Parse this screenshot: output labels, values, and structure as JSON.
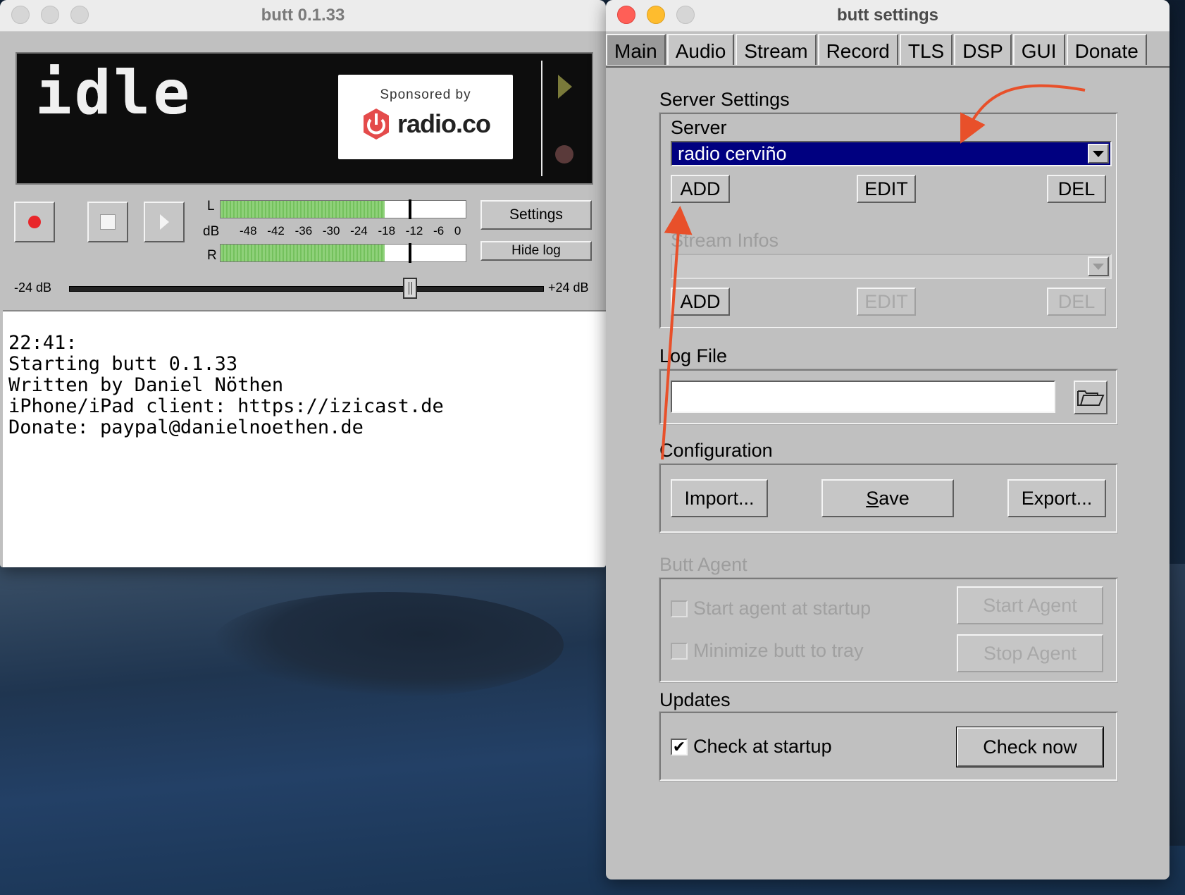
{
  "main_window": {
    "title": "butt 0.1.33",
    "display_status": "idle",
    "sponsor_top": "Sponsored by",
    "sponsor_name": "radio.co",
    "buttons": {
      "settings": "Settings",
      "hide_log": "Hide log"
    },
    "meter": {
      "left_label": "L",
      "right_label": "R",
      "db_label": "dB",
      "scale": "-48 -42 -36 -30 -24 -18 -12 -6 0",
      "left_level": 0.67,
      "right_level": 0.67
    },
    "slider": {
      "min_label": "-24 dB",
      "max_label": "+24 dB",
      "value_db": 8
    },
    "log_lines": [
      "22:41:",
      "Starting butt 0.1.33",
      "Written by Daniel Nöthen",
      "iPhone/iPad client: https://izicast.de",
      "Donate: paypal@danielnoethen.de"
    ]
  },
  "settings_window": {
    "title": "butt settings",
    "tabs": [
      "Main",
      "Audio",
      "Stream",
      "Record",
      "TLS",
      "DSP",
      "GUI",
      "Donate"
    ],
    "active_tab": "Main",
    "server_settings": {
      "label": "Server Settings",
      "server_label": "Server",
      "server_value": "radio cerviño",
      "add": "ADD",
      "edit": "EDIT",
      "del": "DEL",
      "stream_infos_label": "Stream Infos",
      "si_add": "ADD",
      "si_edit": "EDIT",
      "si_del": "DEL"
    },
    "log_file": {
      "label": "Log File",
      "value": ""
    },
    "configuration": {
      "label": "Configuration",
      "import": "Import...",
      "save_pre": "",
      "save_u": "S",
      "save_post": "ave",
      "export": "Export..."
    },
    "butt_agent": {
      "label": "Butt Agent",
      "start_at_startup": "Start agent at startup",
      "minimize_to_tray": "Minimize butt to tray",
      "start_agent": "Start Agent",
      "stop_agent": "Stop Agent"
    },
    "updates": {
      "label": "Updates",
      "check_at_startup": "Check at startup",
      "check_now": "Check now",
      "checked": true
    }
  },
  "colors": {
    "annotation_arrow": "#e8502a",
    "selection": "#000080",
    "meter_green": "#8fd17a",
    "record_red": "#e8262a"
  }
}
